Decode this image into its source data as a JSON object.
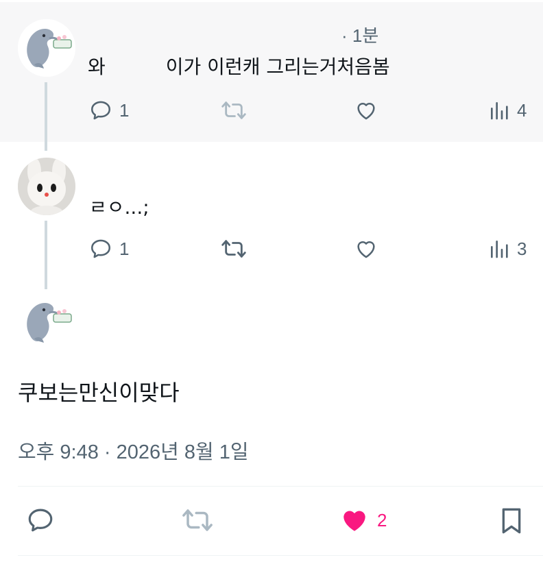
{
  "replies": [
    {
      "time": "· 1분",
      "text_prefix": "와",
      "text_suffix": "이가 이런캐 그리는거처음봄",
      "stats": {
        "replies": "1",
        "retweets": "",
        "likes": "",
        "views": "4"
      }
    },
    {
      "text": "ㄹㅇ...;",
      "stats": {
        "replies": "1",
        "retweets": "",
        "likes": "",
        "views": "3"
      }
    }
  ],
  "main_post": {
    "text": "쿠보는만신이맞다",
    "timestamp": "오후 9:48 · 2026년 8월 1일",
    "likes": "2"
  },
  "colors": {
    "like_active": "#f91880",
    "muted": "#536471",
    "retweet_disabled": "#aab8c2"
  },
  "icons": [
    "reply-icon",
    "retweet-icon",
    "like-icon",
    "views-icon",
    "bookmark-icon",
    "dolphin-avatar",
    "bunny-avatar"
  ]
}
